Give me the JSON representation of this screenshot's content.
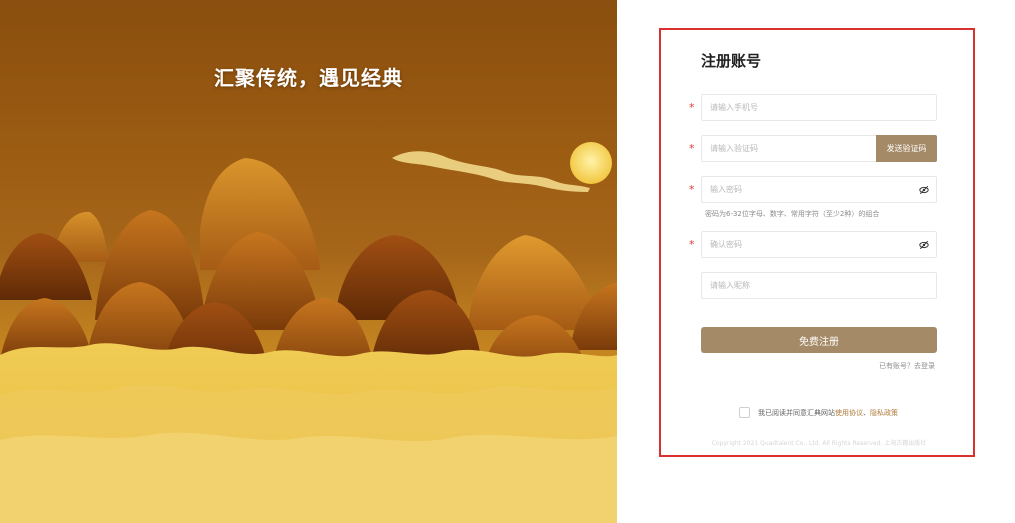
{
  "hero": {
    "slogan": "汇聚传统，遇见经典"
  },
  "register": {
    "title": "注册账号",
    "required_mark": "*",
    "phone_placeholder": "请输入手机号",
    "code_placeholder": "请输入验证码",
    "send_code_label": "发送验证码",
    "password_placeholder": "输入密码",
    "password_hint": "密码为6-32位字母、数字、常用字符（至少2种）的组合",
    "confirm_placeholder": "确认密码",
    "nickname_placeholder": "请输入昵称",
    "submit_label": "免费注册",
    "has_account_text": "已有账号？",
    "login_link": "去登录",
    "agree_prefix": "我已阅读并同意汇典网站",
    "terms_link": "使用协议",
    "agree_sep": "、",
    "privacy_link": "隐私政策",
    "copyright": "Copyright 2021 Quadtalent Co., Ltd. All Rights Reserved. 上海古籍出版社"
  },
  "icons": {
    "password_eye": "eye-off-icon",
    "confirm_eye": "eye-off-icon"
  },
  "colors": {
    "accent": "#a58a67",
    "frame": "#d9312d",
    "required": "#e03a32",
    "link": "#b07a3c"
  }
}
